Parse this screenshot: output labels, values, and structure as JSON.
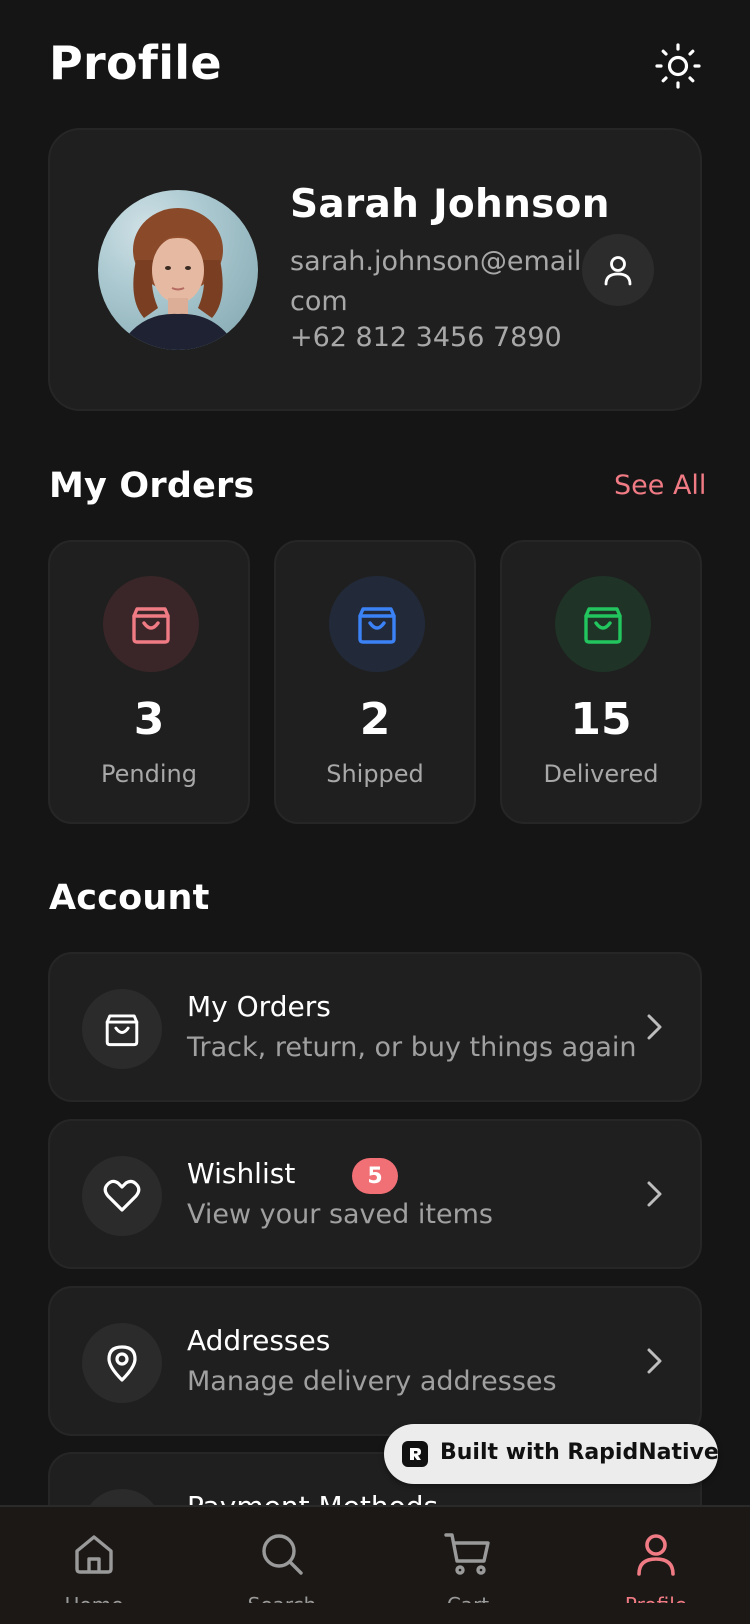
{
  "header": {
    "title": "Profile",
    "theme_icon": "sun-icon"
  },
  "profile": {
    "name": "Sarah Johnson",
    "email": "sarah.johnson@email.com",
    "phone": "+62 812 3456 7890",
    "avatar_alt": "avatar",
    "action_icon": "user-icon"
  },
  "orders": {
    "title": "My Orders",
    "see_all": "See All",
    "stats": [
      {
        "value": "3",
        "label": "Pending",
        "color": "#f07b84",
        "bg": "#3a2628"
      },
      {
        "value": "2",
        "label": "Shipped",
        "color": "#3b82f6",
        "bg": "#222a3a"
      },
      {
        "value": "15",
        "label": "Delivered",
        "color": "#22c55e",
        "bg": "#1f3327"
      }
    ]
  },
  "account": {
    "title": "Account",
    "items": [
      {
        "title": "My Orders",
        "subtitle": "Track, return, or buy things again",
        "icon": "shopping-bag-icon"
      },
      {
        "title": "Wishlist",
        "subtitle": "View your saved items",
        "icon": "heart-icon",
        "badge": "5"
      },
      {
        "title": "Addresses",
        "subtitle": "Manage delivery addresses",
        "icon": "map-pin-icon"
      },
      {
        "title": "Payment Methods",
        "subtitle": "",
        "icon": "credit-card-icon"
      }
    ]
  },
  "built_with": {
    "label": "Built with RapidNative"
  },
  "nav": {
    "items": [
      {
        "label": "Home",
        "icon": "home-icon"
      },
      {
        "label": "Search",
        "icon": "search-icon"
      },
      {
        "label": "Cart",
        "icon": "cart-icon"
      },
      {
        "label": "Profile",
        "icon": "user-icon",
        "active": true
      }
    ]
  },
  "colors": {
    "accent": "#f07b84",
    "background": "#151515",
    "card": "#1f1f1f"
  }
}
